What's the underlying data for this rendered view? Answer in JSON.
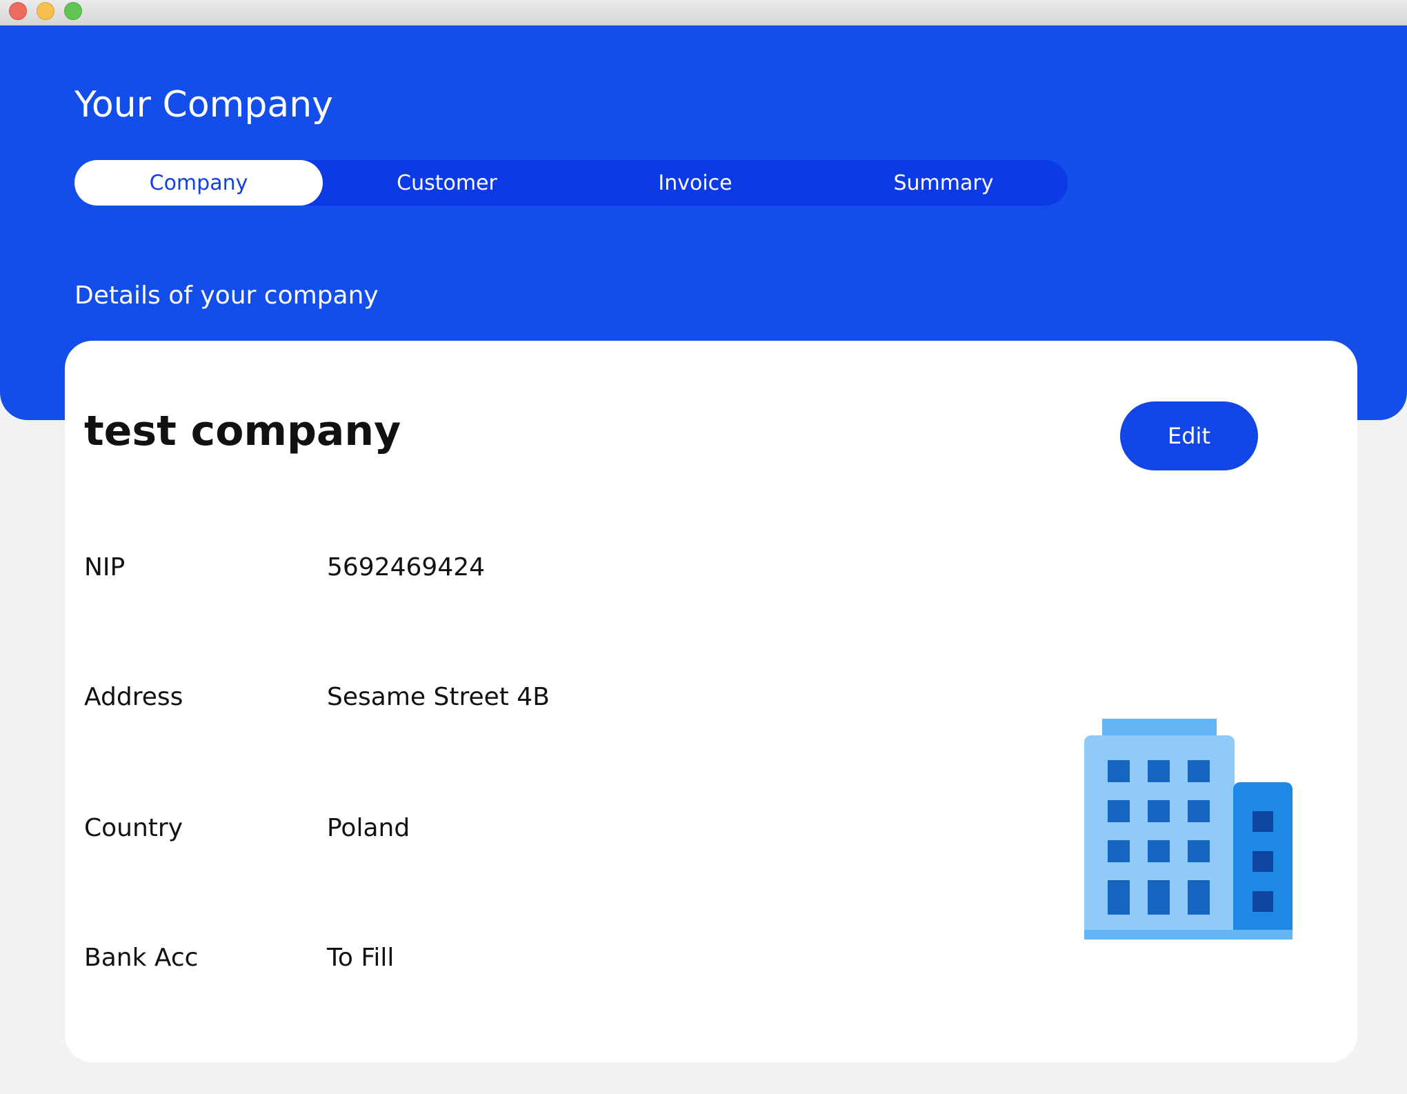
{
  "header": {
    "title": "Your Company",
    "tabs": [
      {
        "label": "Company",
        "active": true
      },
      {
        "label": "Customer",
        "active": false
      },
      {
        "label": "Invoice",
        "active": false
      },
      {
        "label": "Summary",
        "active": false
      }
    ],
    "section_title": "Details of your company"
  },
  "card": {
    "company_name": "test company",
    "edit_label": "Edit",
    "fields": [
      {
        "label": "NIP",
        "value": "5692469424"
      },
      {
        "label": "Address",
        "value": "Sesame Street 4B"
      },
      {
        "label": "Country",
        "value": "Poland"
      },
      {
        "label": "Bank Acc",
        "value": "To Fill"
      }
    ],
    "illustration_icon": "office-building-icon"
  },
  "colors": {
    "primary": "#144eea",
    "tab_track": "#0c3be6",
    "card_background": "#ffffff",
    "page_background": "#f2f2f2"
  }
}
